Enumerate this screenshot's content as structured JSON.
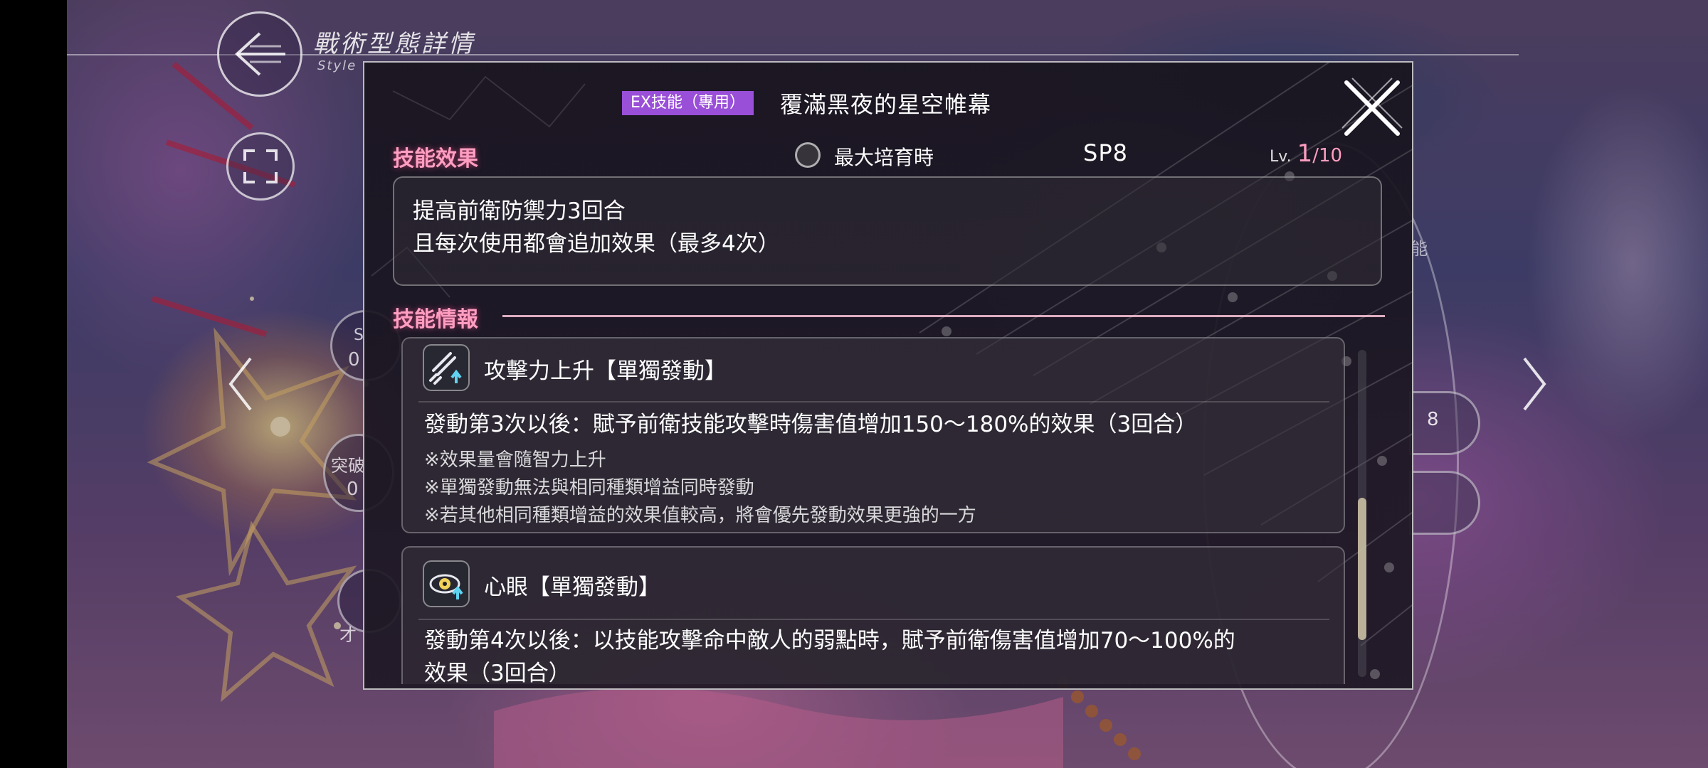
{
  "header": {
    "title": "戰術型態詳情",
    "subtitle": "Style"
  },
  "modal": {
    "skill_tag": "EX技能（專用）",
    "skill_name": "覆滿黑夜的星空帷幕",
    "effect_section_title": "技能效果",
    "max_training_label": "最大培育時",
    "sp": "SP8",
    "level_label": "Lv.",
    "level_current": "1",
    "level_max": "/10",
    "effect_lines": [
      "提高前衛防禦力3回合",
      "且每次使用都會追加效果（最多4次）"
    ],
    "info_section_title": "技能情報",
    "cards": [
      {
        "title": "攻擊力上升【單獨發動】",
        "icon": "sword-up-icon",
        "description": "發動第3次以後：賦予前衛技能攻擊時傷害值增加150～180%的效果（3回合）",
        "notes": [
          "※效果量會隨智力上升",
          "※單獨發動無法與相同種類增益同時發動",
          "※若其他相同種類增益的效果值較高，將會優先發動效果更強的一方"
        ]
      },
      {
        "title": "心眼【單獨發動】",
        "icon": "eye-up-icon",
        "description_lines": [
          "發動第4次以後：以技能攻擊命中敵人的弱點時，賦予前衛傷害值增加70～100%的",
          "效果（3回合）"
        ]
      }
    ]
  },
  "background": {
    "side_pill_value": "8",
    "side_text": "能",
    "left_bubbles": [
      "S",
      "0",
      "突破",
      "0",
      "才"
    ]
  },
  "colors": {
    "accent_pink": "#ff9ec0",
    "tag_purple": "#9a4fd8"
  }
}
